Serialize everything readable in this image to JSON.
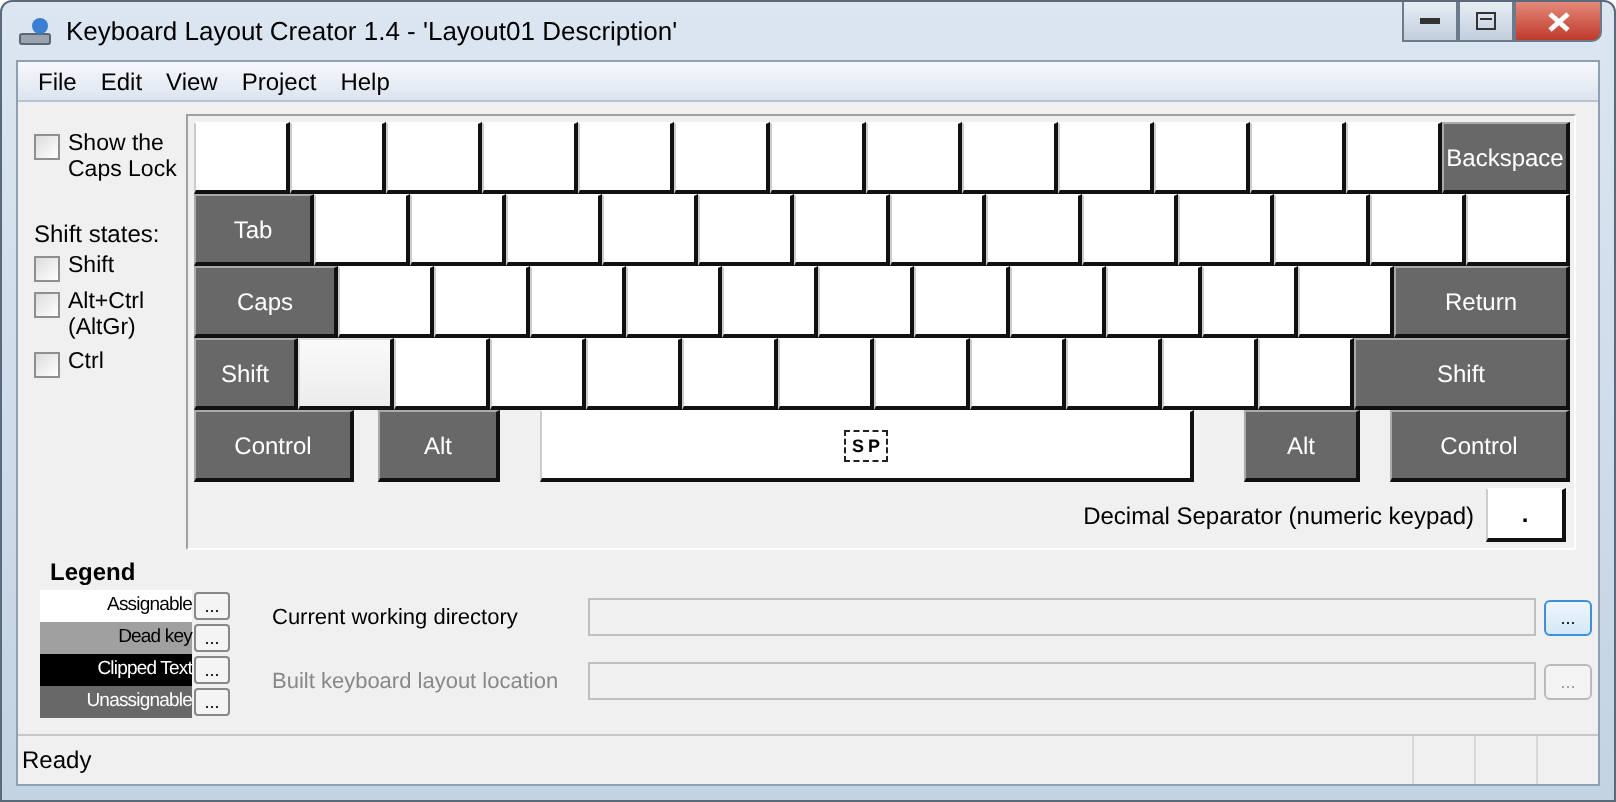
{
  "window": {
    "title": "Keyboard Layout Creator 1.4 - 'Layout01 Description'"
  },
  "menu": [
    "File",
    "Edit",
    "View",
    "Project",
    "Help"
  ],
  "caps_lock_option": {
    "label": "Show the Caps Lock",
    "checked": false
  },
  "shift_states": {
    "title": "Shift states:",
    "items": [
      {
        "label": "Shift",
        "checked": false
      },
      {
        "label": "Alt+Ctrl (AltGr)",
        "checked": false
      },
      {
        "label": "Ctrl",
        "checked": false
      }
    ]
  },
  "keyboard": {
    "rows": [
      [
        {
          "kind": "assignable"
        },
        {
          "kind": "assignable"
        },
        {
          "kind": "assignable"
        },
        {
          "kind": "assignable"
        },
        {
          "kind": "assignable"
        },
        {
          "kind": "assignable"
        },
        {
          "kind": "assignable"
        },
        {
          "kind": "assignable"
        },
        {
          "kind": "assignable"
        },
        {
          "kind": "assignable"
        },
        {
          "kind": "assignable"
        },
        {
          "kind": "assignable"
        },
        {
          "kind": "assignable"
        },
        {
          "kind": "unassignable",
          "label": "Backspace"
        }
      ],
      [
        {
          "kind": "unassignable",
          "label": "Tab"
        },
        {
          "kind": "assignable"
        },
        {
          "kind": "assignable"
        },
        {
          "kind": "assignable"
        },
        {
          "kind": "assignable"
        },
        {
          "kind": "assignable"
        },
        {
          "kind": "assignable"
        },
        {
          "kind": "assignable"
        },
        {
          "kind": "assignable"
        },
        {
          "kind": "assignable"
        },
        {
          "kind": "assignable"
        },
        {
          "kind": "assignable"
        },
        {
          "kind": "assignable"
        },
        {
          "kind": "assignable"
        }
      ],
      [
        {
          "kind": "unassignable",
          "label": "Caps"
        },
        {
          "kind": "assignable"
        },
        {
          "kind": "assignable"
        },
        {
          "kind": "assignable"
        },
        {
          "kind": "assignable"
        },
        {
          "kind": "assignable"
        },
        {
          "kind": "assignable"
        },
        {
          "kind": "assignable"
        },
        {
          "kind": "assignable"
        },
        {
          "kind": "assignable"
        },
        {
          "kind": "assignable"
        },
        {
          "kind": "assignable"
        },
        {
          "kind": "unassignable",
          "label": "Return"
        }
      ],
      [
        {
          "kind": "unassignable",
          "label": "Shift"
        },
        {
          "kind": "highlighted"
        },
        {
          "kind": "assignable"
        },
        {
          "kind": "assignable"
        },
        {
          "kind": "assignable"
        },
        {
          "kind": "assignable"
        },
        {
          "kind": "assignable"
        },
        {
          "kind": "assignable"
        },
        {
          "kind": "assignable"
        },
        {
          "kind": "assignable"
        },
        {
          "kind": "assignable"
        },
        {
          "kind": "assignable"
        },
        {
          "kind": "unassignable",
          "label": "Shift"
        }
      ],
      [
        {
          "kind": "unassignable",
          "label": "Control"
        },
        {
          "kind": "unassignable",
          "label": "Alt"
        },
        {
          "kind": "space",
          "label": "SP",
          "focused": true
        },
        {
          "kind": "unassignable",
          "label": "Alt"
        },
        {
          "kind": "unassignable",
          "label": "Control"
        }
      ]
    ]
  },
  "decimal_separator": {
    "label": "Decimal Separator (numeric keypad)",
    "key": "."
  },
  "legend": {
    "title": "Legend",
    "items": [
      {
        "label": "Assignable",
        "color": "#ffffff"
      },
      {
        "label": "Dead key",
        "color": "#a0a0a0"
      },
      {
        "label": "Clipped Text",
        "color": "#000000"
      },
      {
        "label": "Unassignable",
        "color": "#686868"
      }
    ]
  },
  "paths": [
    {
      "label": "Current working directory",
      "disabled": false
    },
    {
      "label": "Built keyboard layout location",
      "disabled": true
    }
  ],
  "browse_label": "...",
  "status_bar": {
    "text": "Ready"
  }
}
